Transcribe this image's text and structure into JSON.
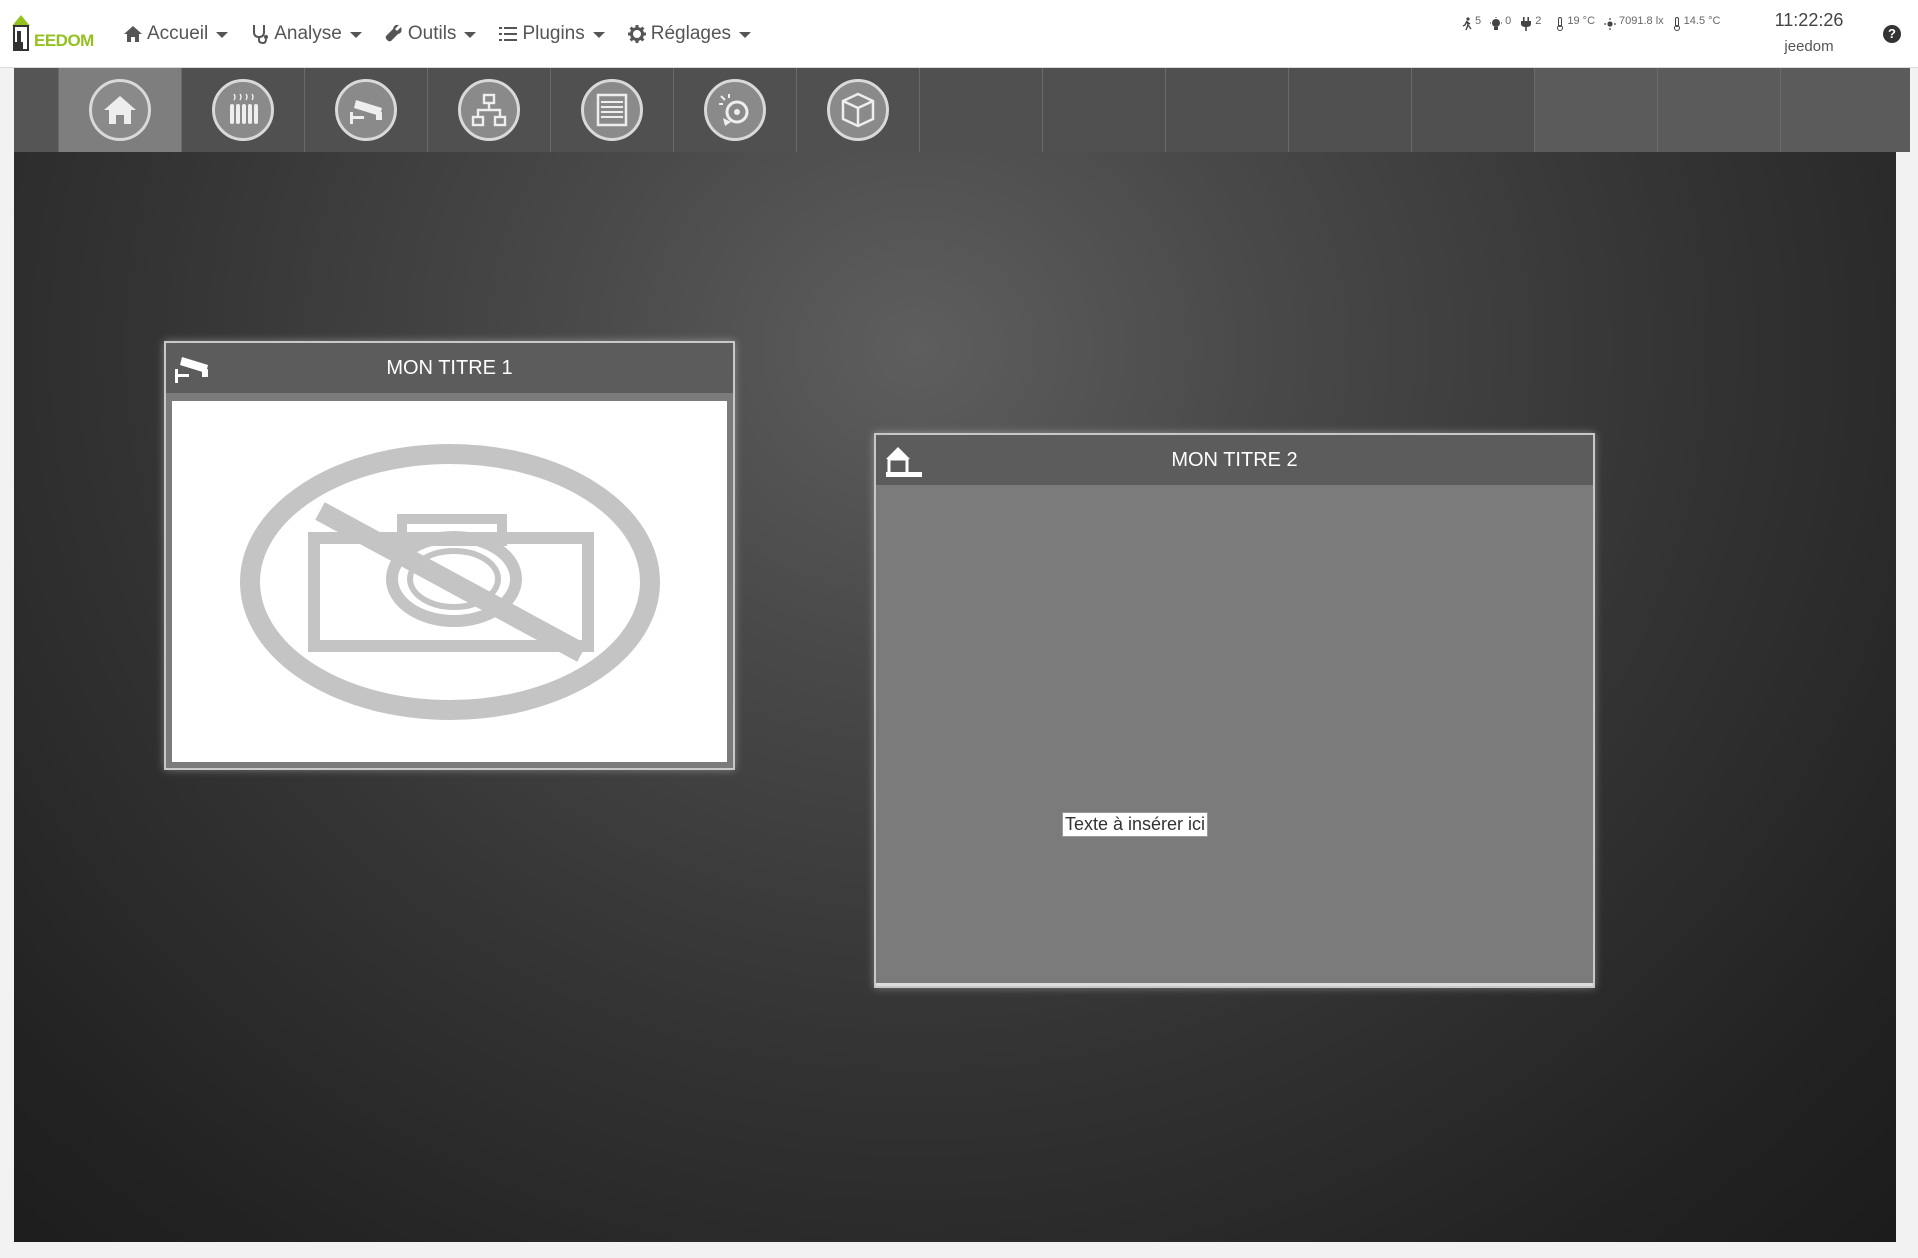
{
  "logo": {
    "text": "EEDOM"
  },
  "menu": [
    {
      "label": "Accueil",
      "icon": "home-icon"
    },
    {
      "label": "Analyse",
      "icon": "stethoscope-icon"
    },
    {
      "label": "Outils",
      "icon": "wrench-icon"
    },
    {
      "label": "Plugins",
      "icon": "list-icon"
    },
    {
      "label": "Réglages",
      "icon": "gear-icon"
    }
  ],
  "status": {
    "motion": "5",
    "light": "0",
    "plug": "2",
    "temp_in": "19 °C",
    "lux": "7091.8 lx",
    "temp_out": "14.5 °C"
  },
  "clock": {
    "time": "11:22:26",
    "user": "jeedom"
  },
  "help": {
    "label": "?"
  },
  "toolbar": {
    "tiles": [
      {
        "icon": "home-icon"
      },
      {
        "icon": "radiator-icon"
      },
      {
        "icon": "camera-cctv-icon"
      },
      {
        "icon": "network-icon"
      },
      {
        "icon": "shutter-icon"
      },
      {
        "icon": "media-icon"
      },
      {
        "icon": "cube-icon"
      }
    ]
  },
  "widgets": {
    "w1": {
      "title": "MON TITRE 1",
      "icon": "camera-cctv-icon",
      "image": "no-camera-icon"
    },
    "w2": {
      "title": "MON TITRE 2",
      "icon": "jeedom-logo-icon",
      "text": "Texte à insérer ici"
    }
  },
  "colors": {
    "brand": "#94c11f",
    "toolbar": "#4f4f4f",
    "widget": "#7b7b7b"
  }
}
